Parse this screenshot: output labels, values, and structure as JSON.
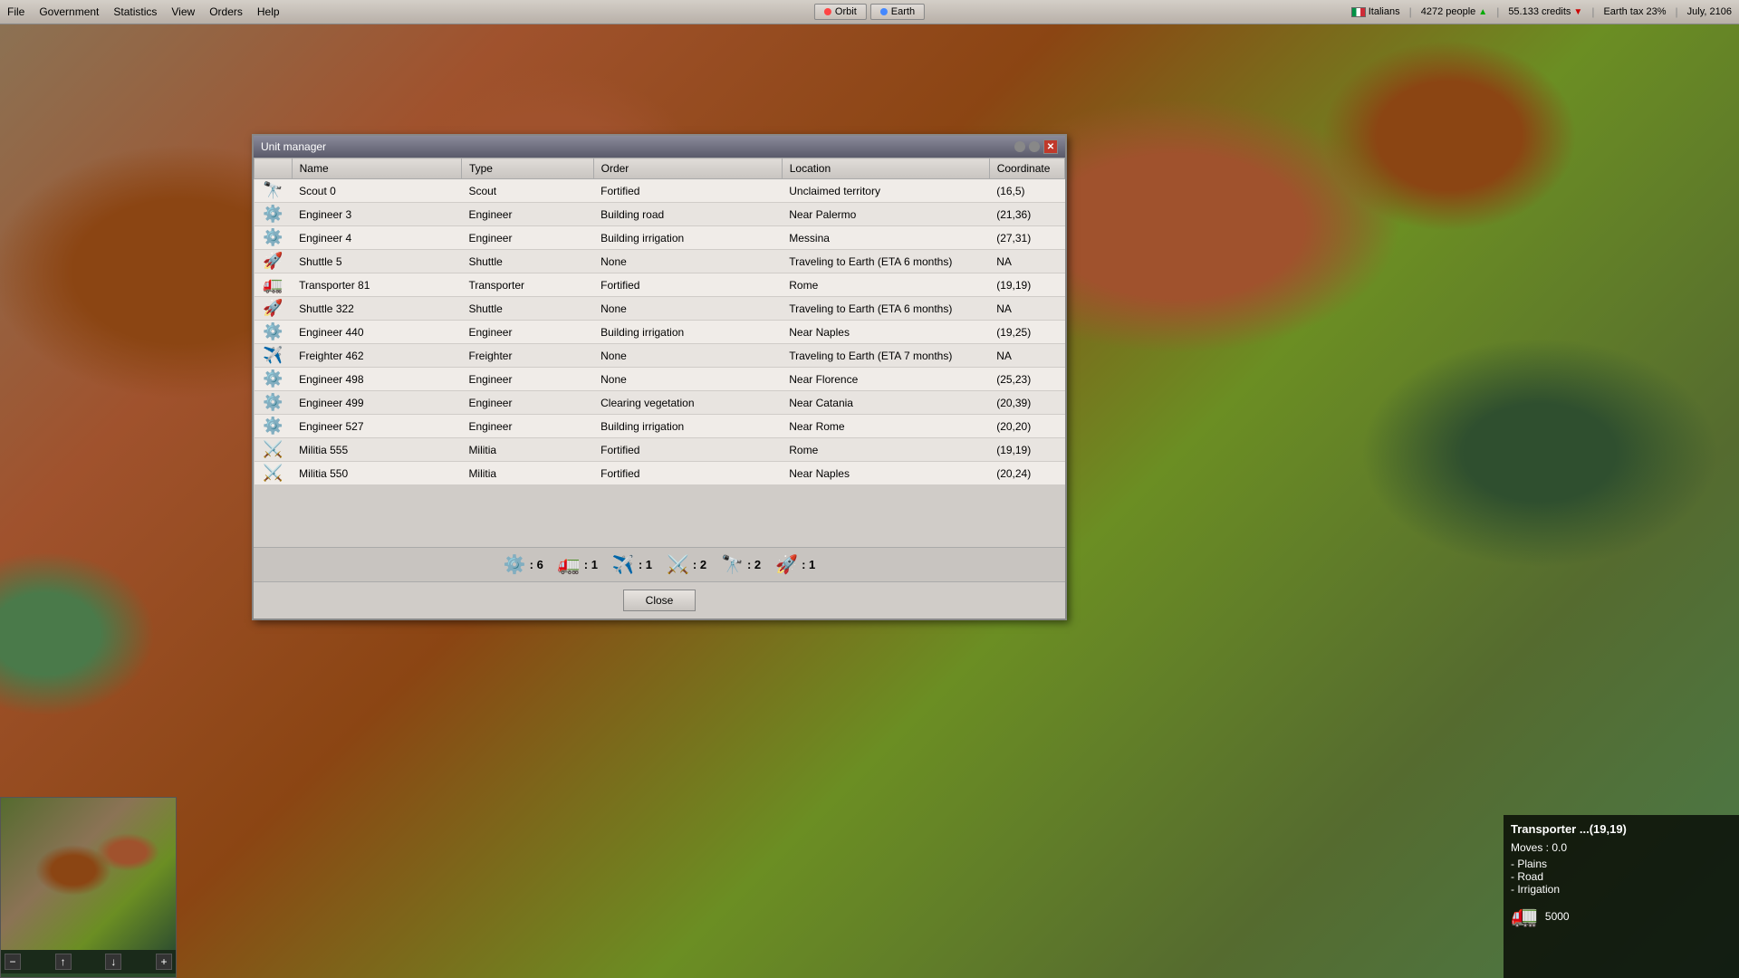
{
  "menubar": {
    "items": [
      {
        "label": "File",
        "id": "file"
      },
      {
        "label": "Government",
        "id": "government"
      },
      {
        "label": "Statistics",
        "id": "statistics"
      },
      {
        "label": "View",
        "id": "view"
      },
      {
        "label": "Orders",
        "id": "orders"
      },
      {
        "label": "Help",
        "id": "help"
      }
    ],
    "location_buttons": [
      {
        "label": "Orbit",
        "id": "orbit"
      },
      {
        "label": "Earth",
        "id": "earth"
      }
    ],
    "status": {
      "nation": "Italians",
      "population": "4272 people",
      "credits": "55.133 credits",
      "tax": "Earth tax 23%",
      "date": "July, 2106"
    }
  },
  "unit_manager": {
    "title": "Unit manager",
    "columns": [
      {
        "label": "",
        "id": "icon"
      },
      {
        "label": "Name",
        "id": "name"
      },
      {
        "label": "Type",
        "id": "type"
      },
      {
        "label": "Order",
        "id": "order"
      },
      {
        "label": "Location",
        "id": "location"
      },
      {
        "label": "Coordinate",
        "id": "coordinate"
      }
    ],
    "units": [
      {
        "icon": "scout",
        "name": "Scout 0",
        "type": "Scout",
        "order": "Fortified",
        "location": "Unclaimed territory",
        "coord": "(16,5)"
      },
      {
        "icon": "engineer",
        "name": "Engineer 3",
        "type": "Engineer",
        "order": "Building road",
        "location": "Near Palermo",
        "coord": "(21,36)"
      },
      {
        "icon": "engineer",
        "name": "Engineer 4",
        "type": "Engineer",
        "order": "Building irrigation",
        "location": "Messina",
        "coord": "(27,31)"
      },
      {
        "icon": "shuttle",
        "name": "Shuttle 5",
        "type": "Shuttle",
        "order": "None",
        "location": "Traveling to Earth (ETA 6 months)",
        "coord": "NA"
      },
      {
        "icon": "transporter",
        "name": "Transporter 81",
        "type": "Transporter",
        "order": "Fortified",
        "location": "Rome",
        "coord": "(19,19)"
      },
      {
        "icon": "shuttle",
        "name": "Shuttle 322",
        "type": "Shuttle",
        "order": "None",
        "location": "Traveling to Earth (ETA 6 months)",
        "coord": "NA"
      },
      {
        "icon": "engineer",
        "name": "Engineer 440",
        "type": "Engineer",
        "order": "Building irrigation",
        "location": "Near Naples",
        "coord": "(19,25)"
      },
      {
        "icon": "freighter",
        "name": "Freighter 462",
        "type": "Freighter",
        "order": "None",
        "location": "Traveling to Earth (ETA 7 months)",
        "coord": "NA"
      },
      {
        "icon": "engineer",
        "name": "Engineer 498",
        "type": "Engineer",
        "order": "None",
        "location": "Near Florence",
        "coord": "(25,23)"
      },
      {
        "icon": "engineer",
        "name": "Engineer 499",
        "type": "Engineer",
        "order": "Clearing vegetation",
        "location": "Near Catania",
        "coord": "(20,39)"
      },
      {
        "icon": "engineer",
        "name": "Engineer 527",
        "type": "Engineer",
        "order": "Building irrigation",
        "location": "Near Rome",
        "coord": "(20,20)"
      },
      {
        "icon": "militia",
        "name": "Militia 555",
        "type": "Militia",
        "order": "Fortified",
        "location": "Rome",
        "coord": "(19,19)"
      },
      {
        "icon": "militia",
        "name": "Militia 550",
        "type": "Militia",
        "order": "Fortified",
        "location": "Near Naples",
        "coord": "(20,24)"
      }
    ],
    "summary": [
      {
        "icon": "engineer",
        "count": "6"
      },
      {
        "icon": "transporter",
        "count": "1"
      },
      {
        "icon": "freighter",
        "count": "1"
      },
      {
        "icon": "militia",
        "count": "2"
      },
      {
        "icon": "scout",
        "count": "2"
      },
      {
        "icon": "shuttle",
        "count": "1"
      }
    ],
    "close_button": "Close"
  },
  "unit_detail": {
    "title": "Transporter ...(19,19)",
    "moves_label": "Moves :",
    "moves_value": "0.0",
    "terrain_items": [
      "- Plains",
      "- Road",
      "- Irrigation"
    ],
    "unit_icon": "transporter",
    "unit_value": "5000"
  },
  "icons": {
    "scout": "🔭",
    "engineer": "⚙",
    "shuttle": "🚀",
    "transporter": "🚛",
    "freighter": "✈",
    "militia": "⚔"
  }
}
